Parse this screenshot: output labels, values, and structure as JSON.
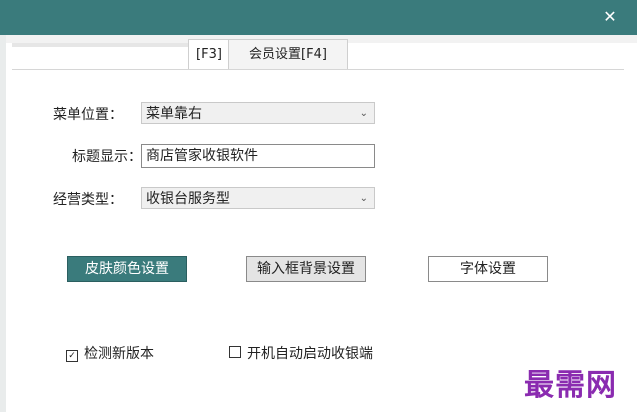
{
  "window": {
    "close_glyph": "✕"
  },
  "tabs": [
    {
      "label": "[F3]"
    },
    {
      "label": "会员设置[F4]"
    }
  ],
  "form": {
    "menu_position": {
      "label": "菜单位置：",
      "value": "菜单靠右"
    },
    "title_display": {
      "label": "标题显示：",
      "value": "商店管家收银软件"
    },
    "business_type": {
      "label": "经营类型：",
      "value": "收银台服务型"
    }
  },
  "buttons": {
    "skin_color": "皮肤颜色设置",
    "input_bg": "输入框背景设置",
    "font": "字体设置"
  },
  "checkboxes": {
    "check_update": {
      "label": "检测新版本",
      "checked": true
    },
    "autostart": {
      "label": "开机自动启动收银端",
      "checked": false
    }
  },
  "watermark": "最需网",
  "colors": {
    "accent": "#3a7b7c",
    "watermark": "#8a2bb0"
  }
}
